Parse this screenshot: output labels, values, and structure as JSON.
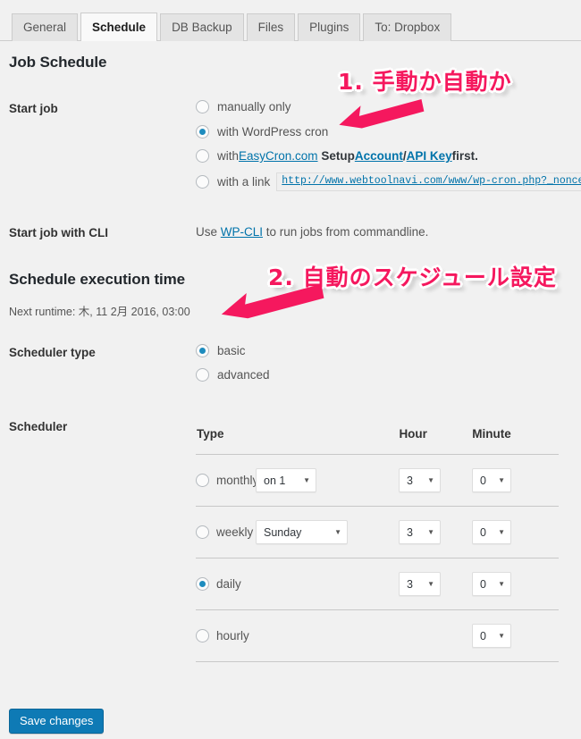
{
  "tabs": [
    {
      "label": "General",
      "active": false
    },
    {
      "label": "Schedule",
      "active": true
    },
    {
      "label": "DB Backup",
      "active": false
    },
    {
      "label": "Files",
      "active": false
    },
    {
      "label": "Plugins",
      "active": false
    },
    {
      "label": "To: Dropbox",
      "active": false
    }
  ],
  "job_schedule": {
    "heading": "Job Schedule",
    "start_job_label": "Start job",
    "options": {
      "manual": "manually only",
      "wp_cron": "with WordPress cron",
      "easycron_prefix": "with ",
      "easycron_link": "EasyCron.com",
      "easycron_setup": "Setup ",
      "easycron_account": "Account",
      "easycron_sep": " / ",
      "easycron_apikey": "API Key",
      "easycron_suffix": " first.",
      "link_label": "with a link",
      "link_url": "http://www.webtoolnavi.com/www/wp-cron.php?_nonce="
    },
    "cli_label": "Start job with CLI",
    "cli_prefix": "Use ",
    "cli_link": "WP-CLI",
    "cli_suffix": " to run jobs from commandline."
  },
  "execution": {
    "heading": "Schedule execution time",
    "next_runtime": "Next runtime: 木, 11 2月 2016, 03:00"
  },
  "scheduler_type": {
    "label": "Scheduler type",
    "basic": "basic",
    "advanced": "advanced",
    "selected": "basic"
  },
  "scheduler": {
    "label": "Scheduler",
    "columns": {
      "type": "Type",
      "hour": "Hour",
      "minute": "Minute"
    },
    "rows": [
      {
        "type": "monthly",
        "selected": false,
        "day": "on 1",
        "hour": "3",
        "minute": "0"
      },
      {
        "type": "weekly",
        "selected": false,
        "day": "Sunday",
        "hour": "3",
        "minute": "0"
      },
      {
        "type": "daily",
        "selected": true,
        "day": null,
        "hour": "3",
        "minute": "0"
      },
      {
        "type": "hourly",
        "selected": false,
        "day": null,
        "hour": null,
        "minute": "0"
      }
    ]
  },
  "footer": {
    "save_label": "Save changes"
  },
  "annotations": [
    {
      "text": "1. 手動か自動か",
      "color": "#f5185e"
    },
    {
      "text": "2. 自動のスケジュール設定",
      "color": "#f5185e"
    }
  ],
  "icons": {
    "caret": "▼"
  }
}
